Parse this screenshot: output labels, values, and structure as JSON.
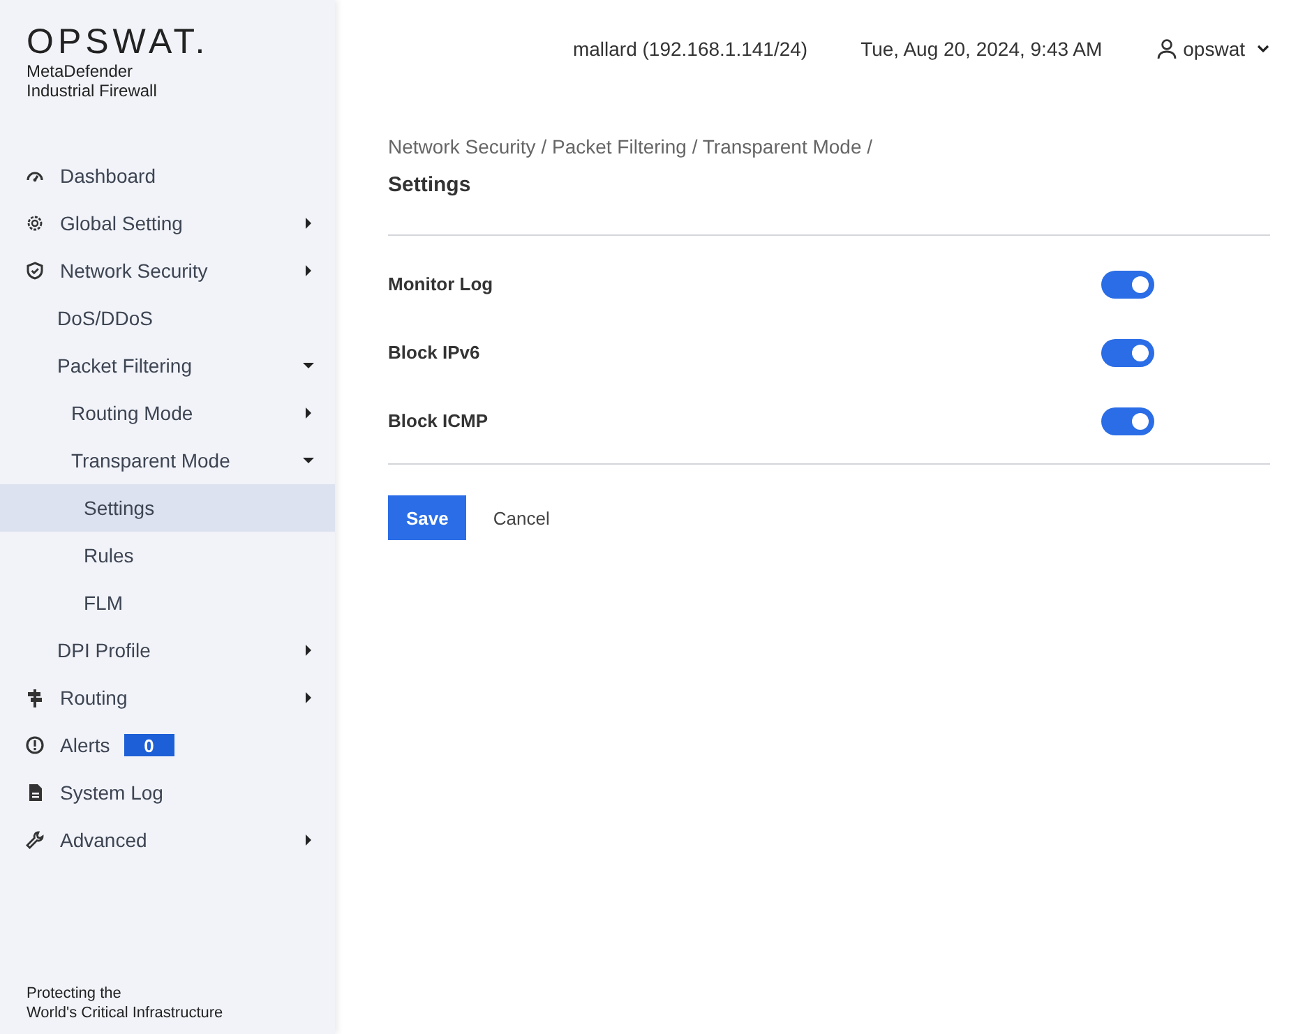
{
  "brand": {
    "logo": "OPSWAT.",
    "product": [
      "MetaDefender",
      "Industrial Firewall"
    ],
    "tagline": [
      "Protecting the",
      "World's Critical Infrastructure"
    ]
  },
  "sidebar": {
    "items": [
      {
        "label": "Dashboard",
        "selected": false
      },
      {
        "label": "Global Setting",
        "expanded": false,
        "selected": false
      },
      {
        "label": "Network Security",
        "expanded": false,
        "selected": false,
        "children": [
          {
            "label": "DoS/DDoS",
            "selected": false
          },
          {
            "label": "Packet Filtering",
            "expanded": true,
            "selected": false,
            "children": [
              {
                "label": "Routing Mode",
                "expanded": false,
                "selected": false
              },
              {
                "label": "Transparent Mode",
                "expanded": true,
                "selected": false,
                "children": [
                  {
                    "label": "Settings",
                    "selected": true
                  },
                  {
                    "label": "Rules",
                    "selected": false
                  },
                  {
                    "label": "FLM",
                    "selected": false
                  }
                ]
              }
            ]
          },
          {
            "label": "DPI Profile",
            "expanded": false,
            "selected": false
          }
        ]
      },
      {
        "label": "Routing",
        "expanded": false,
        "selected": false
      },
      {
        "label": "Alerts",
        "badge": "0",
        "selected": false
      },
      {
        "label": "System Log",
        "selected": false
      },
      {
        "label": "Advanced",
        "expanded": false,
        "selected": false
      }
    ]
  },
  "header": {
    "host": "mallard (192.168.1.141/24)",
    "datetime": "Tue, Aug 20, 2024, 9:43 AM",
    "user": "opswat"
  },
  "breadcrumb": "Network Security / Packet Filtering / Transparent Mode /",
  "title": "Settings",
  "settings": [
    {
      "label": "Monitor Log",
      "on": true
    },
    {
      "label": "Block IPv6",
      "on": true
    },
    {
      "label": "Block ICMP",
      "on": true
    }
  ],
  "buttons": [
    {
      "label": "Save",
      "kind": "primary"
    },
    {
      "label": "Cancel",
      "kind": "text"
    }
  ]
}
